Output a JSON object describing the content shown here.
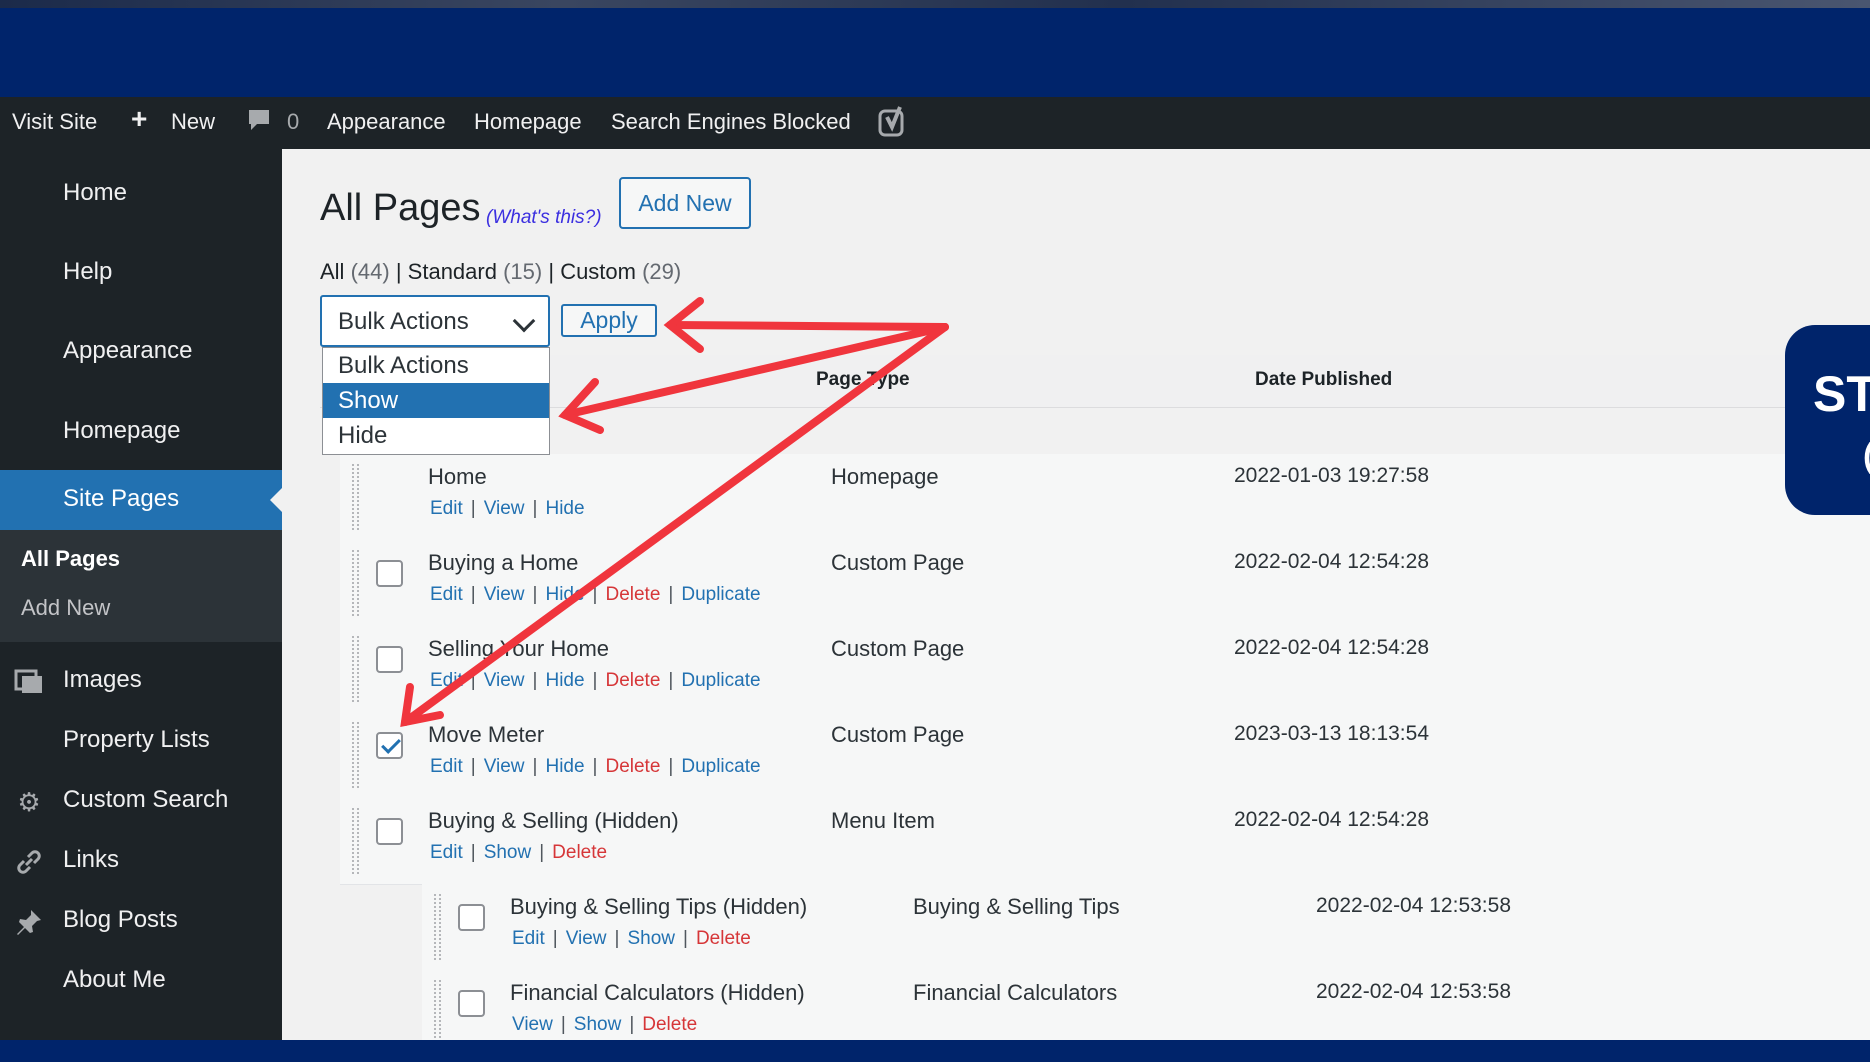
{
  "admin_bar": {
    "visit_site": "Visit Site",
    "new": "New",
    "comments_count": "0",
    "appearance": "Appearance",
    "homepage": "Homepage",
    "search_engines": "Search Engines Blocked"
  },
  "sidebar": {
    "items": [
      {
        "label": "Home"
      },
      {
        "label": "Help"
      },
      {
        "label": "Appearance"
      },
      {
        "label": "Homepage"
      },
      {
        "label": "Site Pages"
      },
      {
        "label": "Images"
      },
      {
        "label": "Property Lists"
      },
      {
        "label": "Custom Search"
      },
      {
        "label": "Links"
      },
      {
        "label": "Blog Posts"
      },
      {
        "label": "About Me"
      }
    ],
    "submenu": [
      {
        "label": "All Pages"
      },
      {
        "label": "Add New"
      }
    ]
  },
  "page": {
    "title": "All Pages",
    "whats_this": "(What's this?)",
    "add_new": "Add New"
  },
  "filters": {
    "all": {
      "label": "All",
      "count": "(44)"
    },
    "standard": {
      "label": "Standard",
      "count": "(15)"
    },
    "custom": {
      "label": "Custom",
      "count": "(29)"
    }
  },
  "bulk": {
    "selected": "Bulk Actions",
    "apply": "Apply",
    "options": [
      "Bulk Actions",
      "Show",
      "Hide"
    ],
    "highlighted": "Show"
  },
  "table": {
    "headers": {
      "page_type": "Page Type",
      "date_published": "Date Published"
    },
    "rows": [
      {
        "title": "Home",
        "type": "Homepage",
        "date": "2022-01-03 19:27:58",
        "actions": [
          "Edit",
          "View",
          "Hide"
        ],
        "checked": false,
        "has_checkbox": false,
        "child": false
      },
      {
        "title": "Buying a Home",
        "type": "Custom Page",
        "date": "2022-02-04 12:54:28",
        "actions": [
          "Edit",
          "View",
          "Hide",
          "Delete",
          "Duplicate"
        ],
        "checked": false,
        "has_checkbox": true,
        "child": false
      },
      {
        "title": "Selling Your Home",
        "type": "Custom Page",
        "date": "2022-02-04 12:54:28",
        "actions": [
          "Edit",
          "View",
          "Hide",
          "Delete",
          "Duplicate"
        ],
        "checked": false,
        "has_checkbox": true,
        "child": false
      },
      {
        "title": "Move Meter",
        "type": "Custom Page",
        "date": "2023-03-13 18:13:54",
        "actions": [
          "Edit",
          "View",
          "Hide",
          "Delete",
          "Duplicate"
        ],
        "checked": true,
        "has_checkbox": true,
        "child": false
      },
      {
        "title": "Buying & Selling (Hidden)",
        "type": "Menu Item",
        "date": "2022-02-04 12:54:28",
        "actions": [
          "Edit",
          "Show",
          "Delete"
        ],
        "checked": false,
        "has_checkbox": true,
        "child": false
      },
      {
        "title": "Buying & Selling Tips (Hidden)",
        "type": "Buying & Selling Tips",
        "date": "2022-02-04 12:53:58",
        "actions": [
          "Edit",
          "View",
          "Show",
          "Delete"
        ],
        "checked": false,
        "has_checkbox": true,
        "child": true
      },
      {
        "title": "Financial Calculators (Hidden)",
        "type": "Financial Calculators",
        "date": "2022-02-04 12:53:58",
        "actions": [
          "View",
          "Show",
          "Delete"
        ],
        "checked": false,
        "has_checkbox": true,
        "child": true
      }
    ]
  },
  "callout": {
    "line1": "ST",
    "line2": "("
  },
  "colors": {
    "frame": "#00246b",
    "accent": "#2271b1",
    "arrow": "#f0353d",
    "delete": "#d63638"
  }
}
